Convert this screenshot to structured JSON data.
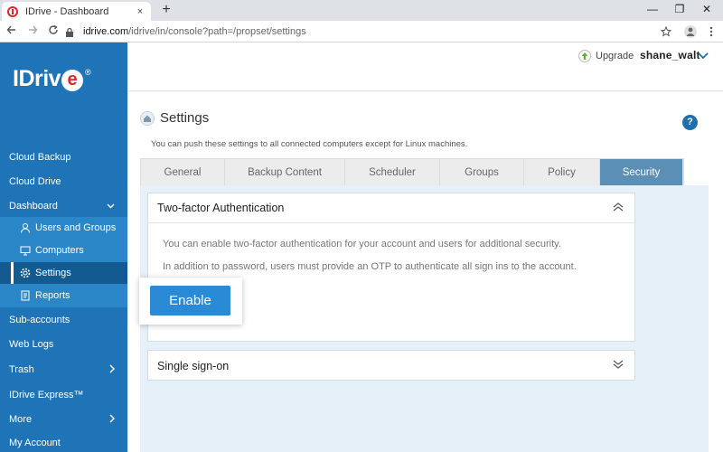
{
  "browser": {
    "tab_title": "IDrive - Dashboard",
    "tab_close": "×",
    "new_tab": "+",
    "url_host": "idrive.com",
    "url_path": "/idrive/in/console?path=/propset/settings",
    "window_minimize": "—",
    "window_restore": "❐",
    "window_close": "✕",
    "back": "←",
    "forward": "→",
    "reload": "C"
  },
  "sidebar": {
    "logo_text": "IDriv",
    "logo_e": "e",
    "logo_reg": "®",
    "items": [
      {
        "label": "Cloud Backup"
      },
      {
        "label": "Cloud Drive"
      },
      {
        "label": "Dashboard"
      },
      {
        "label": "Sub-accounts"
      },
      {
        "label": "Web Logs"
      },
      {
        "label": "Trash"
      },
      {
        "label": "IDrive Express™"
      },
      {
        "label": "More"
      },
      {
        "label": "My Account"
      }
    ],
    "subitems": [
      {
        "label": "Users and Groups",
        "icon": "user-icon"
      },
      {
        "label": "Computers",
        "icon": "computer-icon"
      },
      {
        "label": "Settings",
        "icon": "gear-icon"
      },
      {
        "label": "Reports",
        "icon": "reports-icon"
      }
    ]
  },
  "header": {
    "upgrade_label": "Upgrade",
    "username": "shane_walt"
  },
  "page": {
    "title": "Settings",
    "subtitle": "You can push these settings to all connected computers except for Linux machines.",
    "help": "?",
    "tabs": [
      {
        "label": "General"
      },
      {
        "label": "Backup Content"
      },
      {
        "label": "Scheduler"
      },
      {
        "label": "Groups"
      },
      {
        "label": "Policy"
      },
      {
        "label": "Security"
      }
    ],
    "active_tab": "Security"
  },
  "two_factor": {
    "title": "Two-factor Authentication",
    "line1": "You can enable two-factor authentication for your account and users for additional security.",
    "line2": "In addition to password, users must provide an OTP to authenticate all sign ins to the account.",
    "enable_label": "Enable"
  },
  "sso": {
    "title": "Single sign-on"
  },
  "colors": {
    "sidebar": "#1e74b6",
    "active_tab": "#5b8fb5",
    "enable_button": "#2b8ad6"
  }
}
